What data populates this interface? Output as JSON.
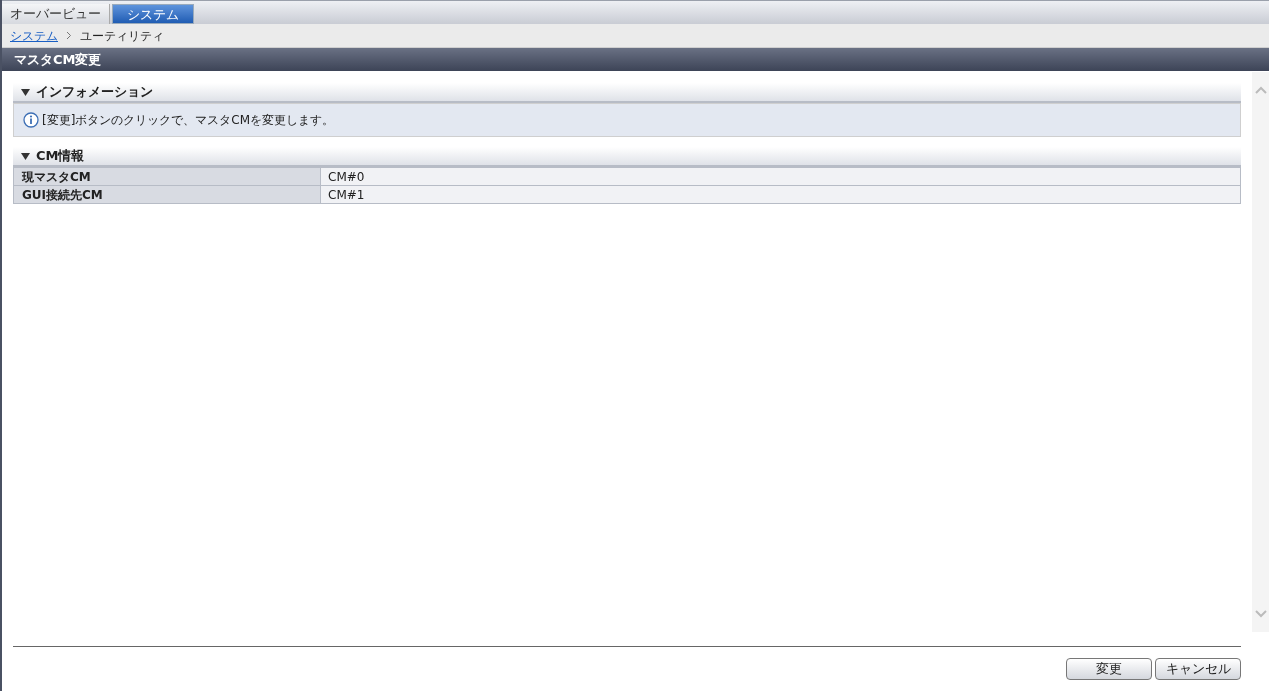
{
  "tabs": [
    {
      "label": "オーバービュー",
      "selected": false
    },
    {
      "label": "システム",
      "selected": true
    }
  ],
  "breadcrumb": {
    "link": "システム",
    "current": "ユーティリティ"
  },
  "page_title": "マスタCM変更",
  "sections": [
    {
      "title": "インフォメーション",
      "expanded": true,
      "kind": "info",
      "message": "[変更]ボタンのクリックで、マスタCMを変更します。"
    },
    {
      "title": "CM情報",
      "expanded": true,
      "kind": "table",
      "rows": [
        {
          "label": "現マスタCM",
          "value": "CM#0"
        },
        {
          "label": "GUI接続先CM",
          "value": "CM#1"
        }
      ]
    }
  ],
  "buttons": [
    "変更",
    "キャンセル"
  ]
}
